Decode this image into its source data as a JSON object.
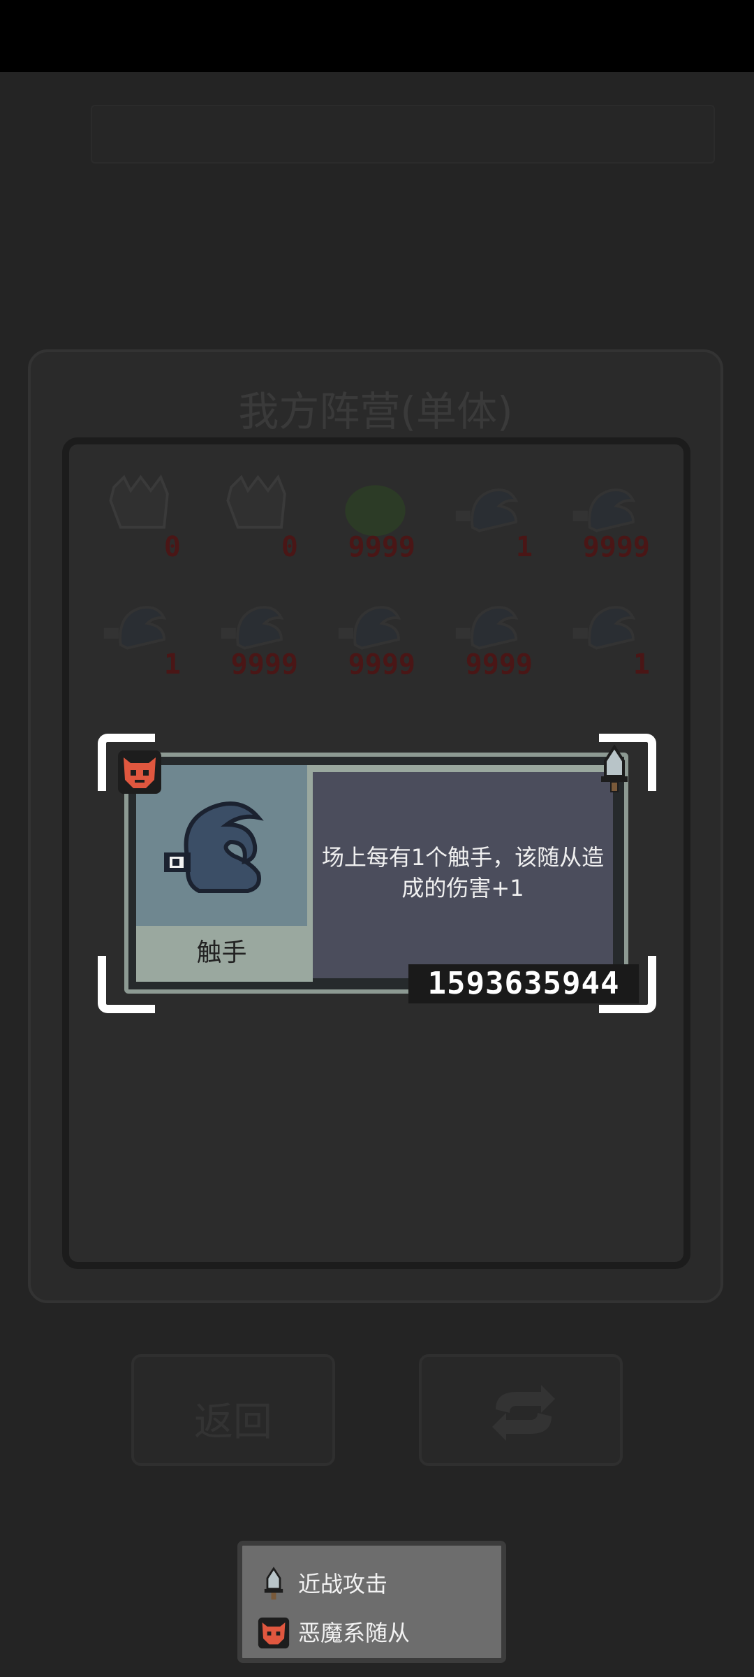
{
  "panel": {
    "title": "我方阵营(单体)"
  },
  "grid": {
    "rows": [
      [
        {
          "type": "demon",
          "count": "0"
        },
        {
          "type": "demon",
          "count": "0"
        },
        {
          "type": "slime",
          "count": "9999"
        },
        {
          "type": "tentacle",
          "count": "1"
        },
        {
          "type": "tentacle",
          "count": "9999"
        }
      ],
      [
        {
          "type": "tentacle",
          "count": "1"
        },
        {
          "type": "tentacle",
          "count": "9999"
        },
        {
          "type": "tentacle",
          "count": "9999"
        },
        {
          "type": "tentacle",
          "count": "9999"
        },
        {
          "type": "tentacle",
          "count": "1"
        }
      ]
    ]
  },
  "buttons": {
    "back_label": "返回",
    "refresh_icon": "refresh-icon"
  },
  "tooltip": {
    "name": "触手",
    "description": "场上每有1个触手，该随从造成的伤害+1",
    "id_number": "1593635944",
    "faction_icon": "demon-mask-icon",
    "attack_icon": "sword-icon"
  },
  "legend": {
    "items": [
      {
        "icon": "sword-icon",
        "label": "近战攻击"
      },
      {
        "icon": "demon-mask-icon",
        "label": "恶魔系随从"
      }
    ]
  },
  "colors": {
    "accent_red": "#b3322b",
    "tooltip_desc_bg": "#4b4d5c",
    "tooltip_image_bg": "#6f8790"
  }
}
